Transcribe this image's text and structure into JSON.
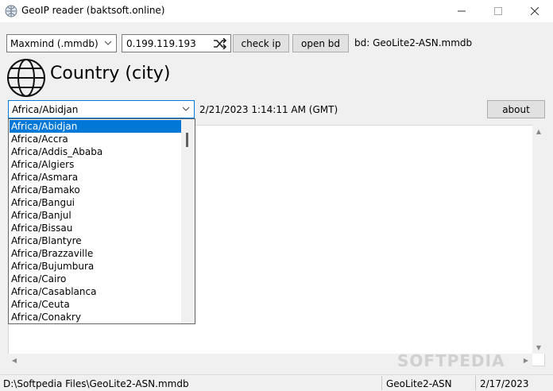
{
  "window": {
    "title": "GeoIP reader (baktsoft.online)"
  },
  "toolbar": {
    "db_format": "Maxmind (.mmdb)",
    "ip_value": "0.199.119.193",
    "check_ip_label": "check ip",
    "open_bd_label": "open bd",
    "bd_label": "bd: GeoLite2-ASN.mmdb"
  },
  "heading": {
    "text": "Country (city)"
  },
  "timezone": {
    "selected": "Africa/Abidjan",
    "datetime": "2/21/2023 1:14:11 AM (GMT)",
    "options": [
      "Africa/Abidjan",
      "Africa/Accra",
      "Africa/Addis_Ababa",
      "Africa/Algiers",
      "Africa/Asmara",
      "Africa/Bamako",
      "Africa/Bangui",
      "Africa/Banjul",
      "Africa/Bissau",
      "Africa/Blantyre",
      "Africa/Brazzaville",
      "Africa/Bujumbura",
      "Africa/Cairo",
      "Africa/Casablanca",
      "Africa/Ceuta",
      "Africa/Conakry"
    ]
  },
  "about_label": "about",
  "statusbar": {
    "path": "D:\\Softpedia Files\\GeoLite2-ASN.mmdb",
    "db": "GeoLite2-ASN",
    "date": "2/17/2023"
  },
  "watermark": "SOFTPEDIA",
  "icons": [
    "app-icon",
    "minimize-icon",
    "maximize-icon",
    "close-icon",
    "chevron-down-icon",
    "shuffle-icon",
    "globe-icon"
  ],
  "colors": {
    "accent": "#0078d7",
    "background": "#f0f0f0"
  }
}
